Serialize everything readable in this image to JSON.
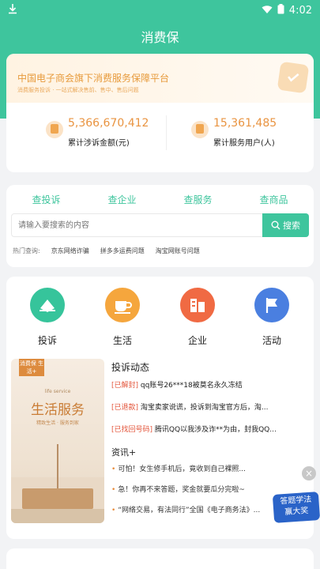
{
  "status": {
    "time": "4:02"
  },
  "app": {
    "title": "消费保"
  },
  "platform": {
    "title": "中国电子商会旗下消费服务保障平台",
    "subtitle": "消费服务投诉 · 一站式解决售前、售中、售后问题",
    "stats": [
      {
        "value": "5,366,670,412",
        "label": "累计涉诉金额(元)"
      },
      {
        "value": "15,361,485",
        "label": "累计服务用户(人)"
      }
    ]
  },
  "search": {
    "tabs": [
      "查投诉",
      "查企业",
      "查服务",
      "查商品"
    ],
    "placeholder": "请输入要搜索的内容",
    "button": "搜索",
    "hot_label": "热门查询:",
    "hot_items": [
      "京东网络诈骗",
      "拼多多运费问题",
      "淘宝网账号问题"
    ]
  },
  "categories": [
    {
      "label": "投诉",
      "color": "#36c49b"
    },
    {
      "label": "生活",
      "color": "#f5a63d"
    },
    {
      "label": "企业",
      "color": "#f06a43"
    },
    {
      "label": "活动",
      "color": "#4a7fe0"
    }
  ],
  "promo": {
    "tag": "消费保 生活+",
    "en": "life service",
    "title": "生活服务",
    "sub": "精致生活 · 服务到家"
  },
  "complaints": {
    "title": "投诉动态",
    "items": [
      {
        "badge": "[已解封]",
        "text": "qq账号26***18被莫名永久冻结"
      },
      {
        "badge": "[已退款]",
        "text": "淘宝卖家说谎，投诉到淘宝官方后，淘..."
      },
      {
        "badge": "[已找回号码]",
        "text": "腾讯QQ以我涉及诈**为由，封我QQ..."
      }
    ]
  },
  "info": {
    "title": "资讯+",
    "items": [
      "可怕！女生修手机后，竟收到自己裸照...",
      "急！你再不来答题，奖金就要瓜分完啦~",
      "“网络交易，有法同行”全国《电子商务法》..."
    ]
  },
  "floating_ad": {
    "line1": "答题学法",
    "line2": "赢大奖"
  }
}
